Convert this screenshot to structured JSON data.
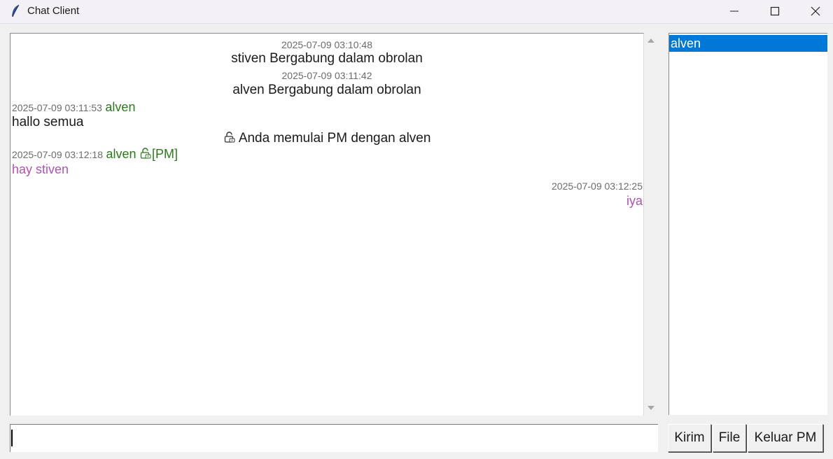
{
  "window": {
    "title": "Chat Client"
  },
  "chat": {
    "messages": [
      {
        "timestamp": "2025-07-09 03:10:48",
        "text": "stiven Bergabung dalam obrolan"
      },
      {
        "timestamp": "2025-07-09 03:11:42",
        "text": "alven Bergabung dalam obrolan"
      },
      {
        "timestamp": "2025-07-09 03:11:53",
        "sender": "alven",
        "text": "hallo semua"
      },
      {
        "text": "Anda memulai PM dengan alven"
      },
      {
        "timestamp": "2025-07-09 03:12:18",
        "sender": "alven",
        "tag": "[PM]",
        "text": "hay stiven"
      },
      {
        "timestamp": "2025-07-09 03:12:25",
        "text": "iya"
      }
    ]
  },
  "users": {
    "items": [
      "alven"
    ]
  },
  "input": {
    "value": ""
  },
  "buttons": {
    "send_label": "Kirim",
    "file_label": "File",
    "leave_pm_label": "Keluar PM"
  },
  "colors": {
    "selection": "#0078d7",
    "sender_name": "#2a7a1a",
    "pm_message": "#b050b8",
    "timestamp": "#6b6b6b"
  },
  "icons": {
    "app": "feather-icon",
    "pm": "lock-icon"
  }
}
